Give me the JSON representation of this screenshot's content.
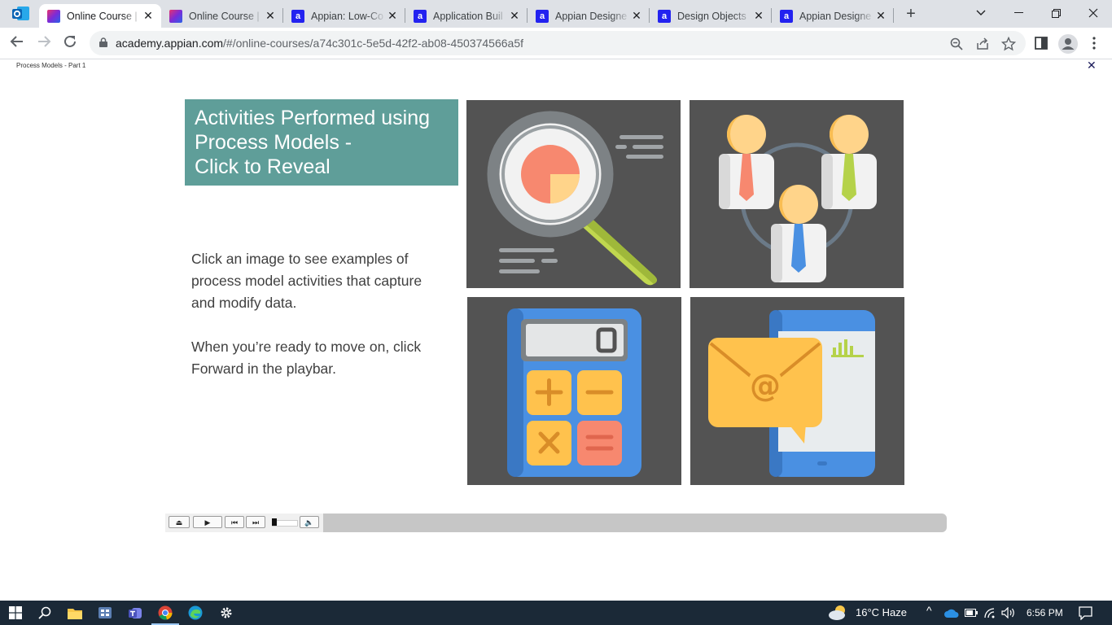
{
  "browser": {
    "tabs": [
      {
        "title": "Online Course |",
        "favicon": "oc",
        "active": true
      },
      {
        "title": "Online Course |",
        "favicon": "oc",
        "active": false
      },
      {
        "title": "Appian: Low-Co",
        "favicon": "a",
        "active": false
      },
      {
        "title": "Application Buil",
        "favicon": "a",
        "active": false
      },
      {
        "title": "Appian Designe",
        "favicon": "a",
        "active": false
      },
      {
        "title": "Design Objects",
        "favicon": "a",
        "active": false
      },
      {
        "title": "Appian Designe",
        "favicon": "a",
        "active": false
      }
    ],
    "url_host": "academy.appian.com",
    "url_path": "/#/online-courses/a74c301c-5e5d-42f2-ab08-450374566a5f"
  },
  "lesson": {
    "breadcrumb": "Process Models - Part 1",
    "title": "Activities Performed using\nProcess Models -\nClick to Reveal",
    "paragraph1": "Click an image to see examples of\nprocess model activities that capture\nand modify data.",
    "paragraph2": "When you’re ready to move on, click\nForward in the playbar.",
    "tiles": [
      {
        "name": "magnifier-chart-icon"
      },
      {
        "name": "people-network-icon"
      },
      {
        "name": "calculator-icon"
      },
      {
        "name": "email-phone-icon"
      }
    ]
  },
  "playbar": {
    "buttons": [
      "exit",
      "play",
      "rewind",
      "forward",
      "volume"
    ]
  },
  "taskbar": {
    "weather": "16°C  Haze",
    "time": "6:56 PM"
  },
  "colors": {
    "tile_bg": "#535353",
    "title_bg": "#5f9e99",
    "taskbar_bg": "#1b2937",
    "tabstrip_bg": "#dee1e6"
  }
}
